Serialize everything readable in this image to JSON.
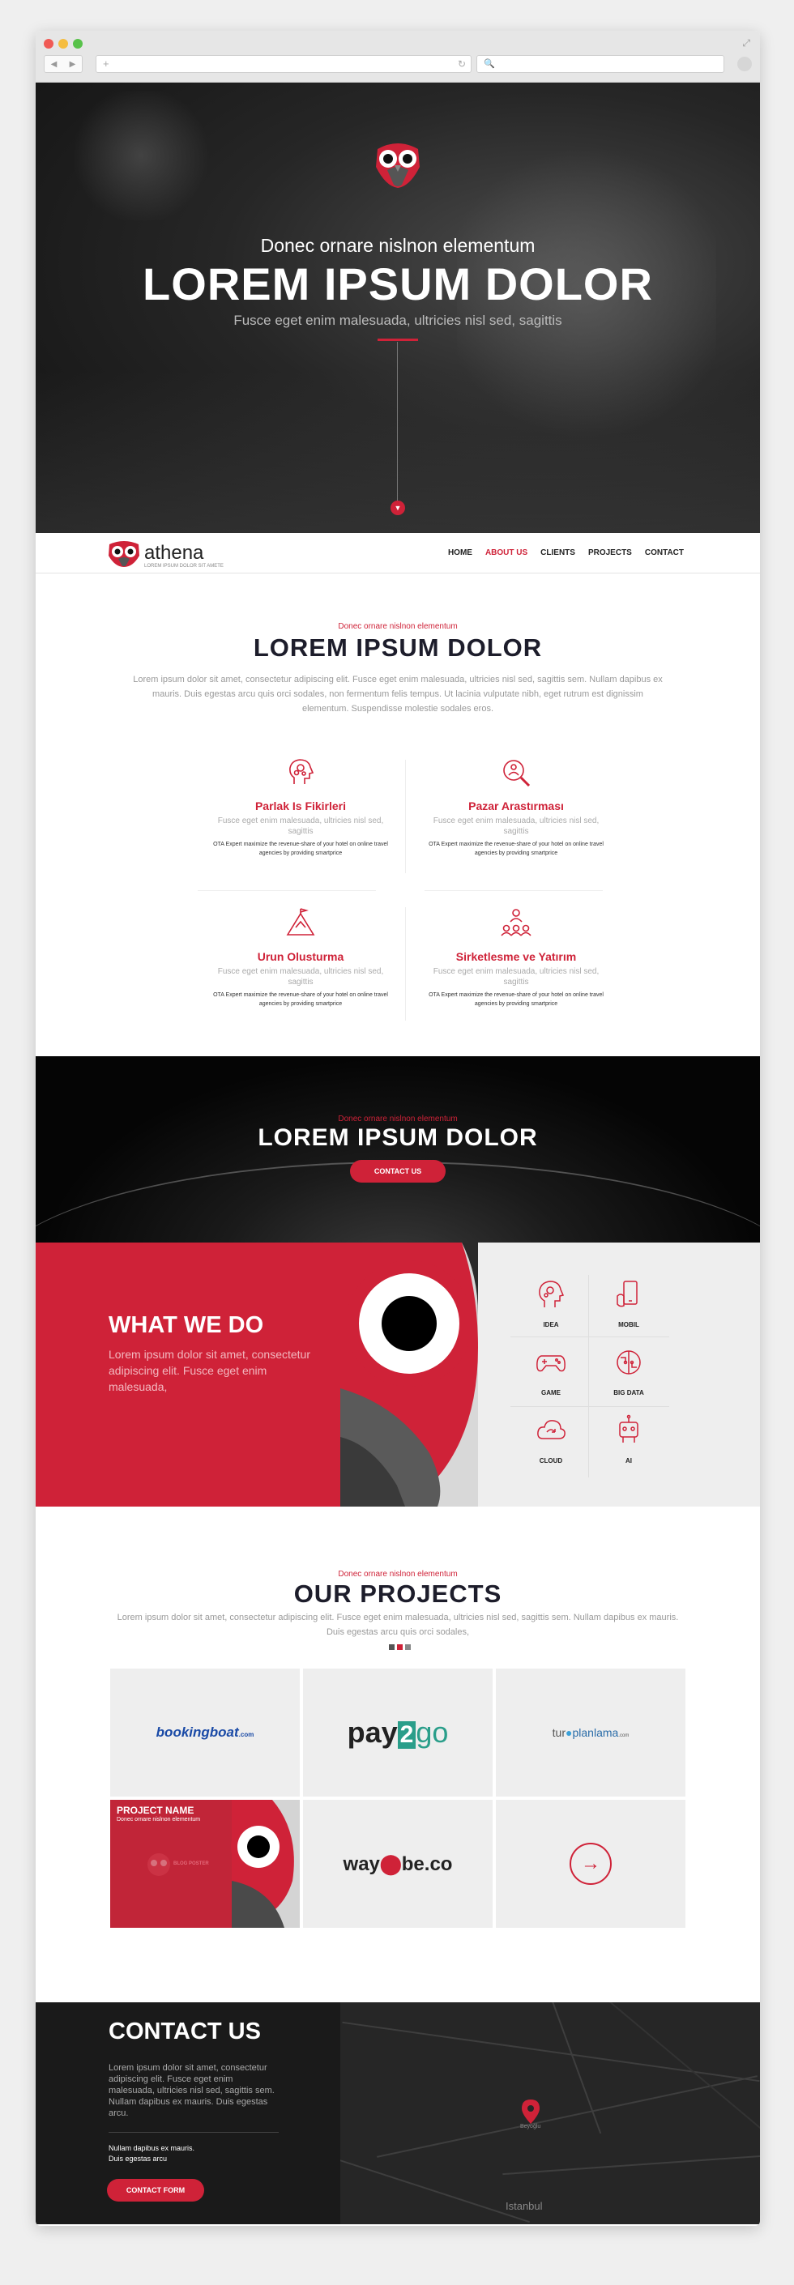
{
  "browser": {
    "back": "◀",
    "forward": "▶",
    "new_tab": "+",
    "reload": "↻",
    "search_icon": "🔍",
    "expand": "⤢"
  },
  "hero": {
    "subtitle": "Donec ornare nislnon elementum",
    "title": "LOREM IPSUM DOLOR",
    "tagline": "Fusce eget enim malesuada, ultricies nisl sed, sagittis",
    "scroll_icon": "▼"
  },
  "nav": {
    "brand": "athena",
    "brand_tagline": "LOREM IPSUM DOLOR SIT AMETE",
    "items": [
      "HOME",
      "ABOUT US",
      "CLIENTS",
      "PROJECTS",
      "CONTACT"
    ],
    "active": "ABOUT US"
  },
  "about": {
    "kicker": "Donec ornare nislnon elementum",
    "title": "LOREM IPSUM DOLOR",
    "lead": "Lorem ipsum dolor sit amet, consectetur adipiscing elit. Fusce eget enim malesuada, ultricies nisl sed, sagittis sem. Nullam dapibus ex mauris. Duis egestas arcu quis orci sodales, non fermentum felis tempus. Ut lacinia vulputate nibh, eget rutrum est dignissim elementum. Suspendisse molestie sodales eros.",
    "features": [
      {
        "icon": "brain-gears-icon",
        "title": "Parlak Is Fikirleri",
        "subtitle": "Fusce eget enim malesuada, ultricies nisl sed, sagittis",
        "desc": "OTA Expert maximize the revenue-share of your hotel on online travel agencies by providing smartprice"
      },
      {
        "icon": "magnifier-people-icon",
        "title": "Pazar Arastırması",
        "subtitle": "Fusce eget enim malesuada, ultricies nisl sed, sagittis",
        "desc": "OTA Expert maximize the revenue-share of your hotel on online travel agencies by providing smartprice"
      },
      {
        "icon": "mountain-flag-icon",
        "title": "Urun Olusturma",
        "subtitle": "Fusce eget enim malesuada, ultricies nisl sed, sagittis",
        "desc": "OTA Expert maximize the revenue-share of your hotel on online travel agencies by providing smartprice"
      },
      {
        "icon": "team-network-icon",
        "title": "Sirketlesme ve Yatırım",
        "subtitle": "Fusce eget enim malesuada, ultricies nisl sed, sagittis",
        "desc": "OTA Expert maximize the revenue-share of your hotel on online travel agencies by providing smartprice"
      }
    ]
  },
  "cta": {
    "kicker": "Donec ornare nislnon elementum",
    "title": "LOREM IPSUM DOLOR",
    "button": "CONTACT US"
  },
  "what_we_do": {
    "title": "WHAT WE DO",
    "text": "Lorem ipsum dolor sit amet, consectetur adipiscing elit. Fusce eget enim malesuada,",
    "services": [
      {
        "label": "IDEA",
        "icon": "head-gears-icon"
      },
      {
        "label": "MOBIL",
        "icon": "mobile-hand-icon"
      },
      {
        "label": "GAME",
        "icon": "gamepad-icon"
      },
      {
        "label": "BIG DATA",
        "icon": "brain-circuit-icon"
      },
      {
        "label": "CLOUD",
        "icon": "cloud-sync-icon"
      },
      {
        "label": "AI",
        "icon": "robot-icon"
      }
    ]
  },
  "projects": {
    "kicker": "Donec ornare nislnon elementum",
    "title": "OUR PROJECTS",
    "lead": "Lorem ipsum dolor sit amet, consectetur adipiscing elit. Fusce eget enim malesuada, ultricies nisl sed, sagittis sem. Nullam dapibus ex mauris. Duis egestas arcu quis orci sodales,",
    "dot_colors": [
      "#555555",
      "#cf2238",
      "#888888"
    ],
    "logos": {
      "booking_main": "bookingboat",
      "booking_suffix": ".com",
      "pay_a": "pay",
      "pay_b": "2",
      "pay_c": "go",
      "tur_a": "tur",
      "tur_b": "planlama",
      "tur_c": ".com",
      "way_a": "way",
      "way_b": "be.co"
    },
    "feature_card": {
      "name": "PROJECT NAME",
      "subtitle": "Donec ornare nislnon elementum",
      "mark": "BLOG POSTER"
    },
    "next_icon": "→"
  },
  "contact": {
    "title": "CONTACT US",
    "text": "Lorem ipsum dolor sit amet, consectetur adipiscing elit. Fusce eget enim malesuada, ultricies nisl sed, sagittis sem. Nullam dapibus ex mauris. Duis egestas arcu.",
    "small_line1": "Nullam dapibus ex mauris.",
    "small_line2": "Duis egestas arcu",
    "button": "CONTACT FORM",
    "map_city": "Istanbul",
    "map_pin_label": "Beyoğlu"
  },
  "colors": {
    "accent": "#cf2238",
    "dark": "#1d1d2b"
  }
}
